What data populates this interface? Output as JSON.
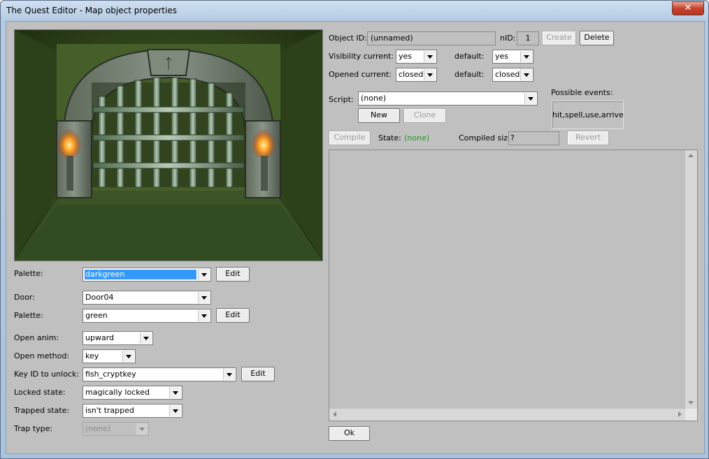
{
  "window": {
    "title": "The Quest Editor - Map object properties",
    "close_glyph": "✕"
  },
  "left": {
    "palette1": {
      "label": "Palette:",
      "value": "darkgreen",
      "edit": "Edit"
    },
    "door": {
      "label": "Door:",
      "value": "Door04"
    },
    "palette2": {
      "label": "Palette:",
      "value": "green",
      "edit": "Edit"
    },
    "open_anim": {
      "label": "Open anim:",
      "value": "upward"
    },
    "open_method": {
      "label": "Open method:",
      "value": "key"
    },
    "key_id": {
      "label": "Key ID to unlock:",
      "value": "fish_cryptkey",
      "edit": "Edit"
    },
    "locked_state": {
      "label": "Locked state:",
      "value": "magically locked"
    },
    "trapped_state": {
      "label": "Trapped state:",
      "value": "isn't trapped"
    },
    "trap_type": {
      "label": "Trap type:",
      "value": "(none)"
    }
  },
  "right": {
    "object_id": {
      "label": "Object ID:",
      "value": "(unnamed)"
    },
    "nid": {
      "label": "nID:",
      "value": "1"
    },
    "create": "Create",
    "delete": "Delete",
    "visibility": {
      "label": "Visibility current:",
      "current": "yes",
      "default_label": "default:",
      "default": "yes"
    },
    "opened": {
      "label": "Opened current:",
      "current": "closed",
      "default_label": "default:",
      "default": "closed"
    },
    "script": {
      "label": "Script:",
      "value": "(none)",
      "new": "New",
      "clone": "Clone"
    },
    "events": {
      "label": "Possible events:",
      "value": "hit,spell,use,arrive"
    },
    "compile": "Compile",
    "state": {
      "label": "State:",
      "value": "(none)"
    },
    "compiled_size": {
      "label": "Compiled size:",
      "value": "?"
    },
    "revert": "Revert",
    "ok": "Ok"
  },
  "colors": {
    "state_value": "#1e9a1e",
    "selection": "#3399ff"
  }
}
